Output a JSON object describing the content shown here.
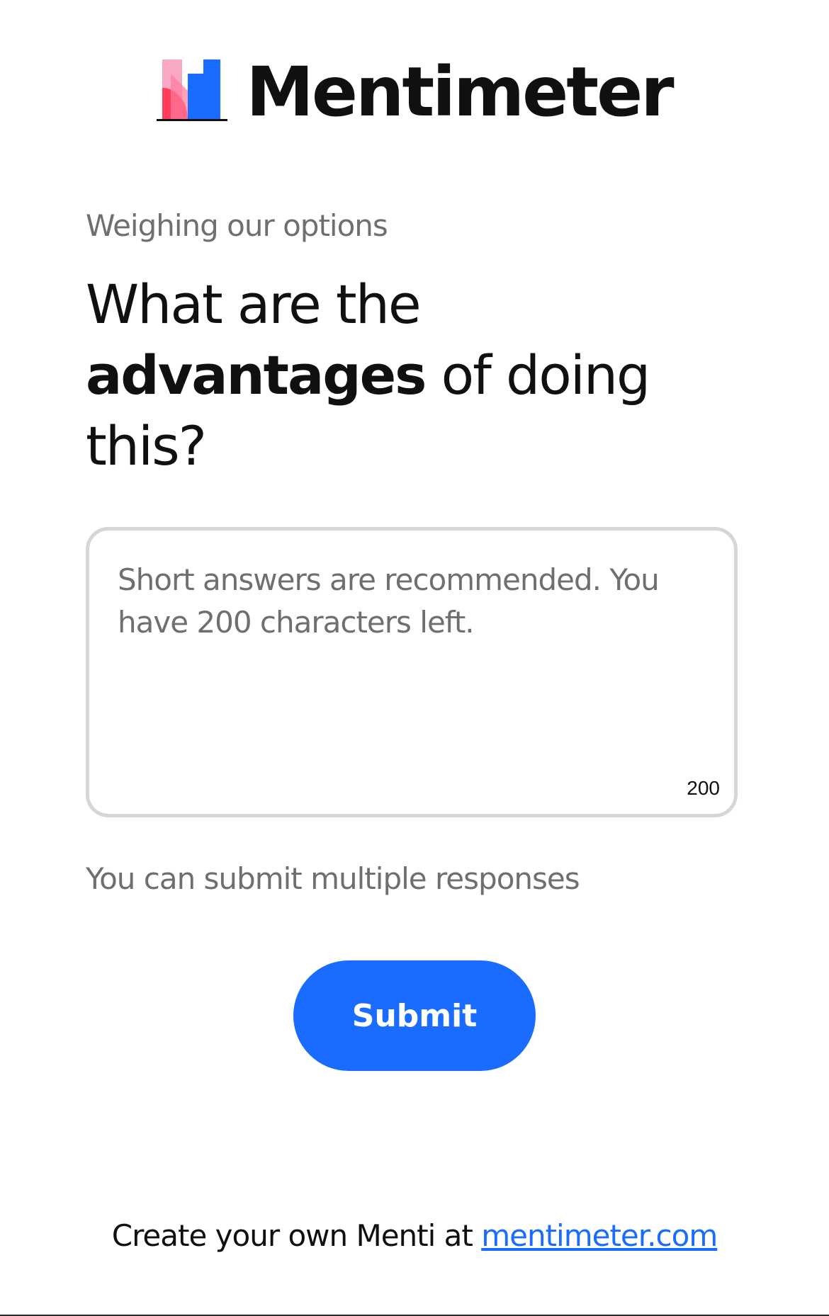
{
  "brand": {
    "name": "Mentimeter",
    "logo_colors": [
      "#f7a8c4",
      "#ff3d5b",
      "#196cff"
    ]
  },
  "slide": {
    "subtitle": "Weighing our options",
    "question": {
      "prefix": "What are the ",
      "emphasis": "advantages",
      "suffix": " of doing this?"
    }
  },
  "answer": {
    "value": "",
    "placeholder": "Short answers are recommended. You have 200 characters left.",
    "characters_left": "200"
  },
  "note": "You can submit multiple responses",
  "submit_label": "Submit",
  "footer": {
    "text": "Create your own Menti at ",
    "link_label": "mentimeter.com"
  },
  "colors": {
    "accent": "#196cff",
    "muted_text": "#6f6f6f",
    "border": "#d6d6d6"
  }
}
